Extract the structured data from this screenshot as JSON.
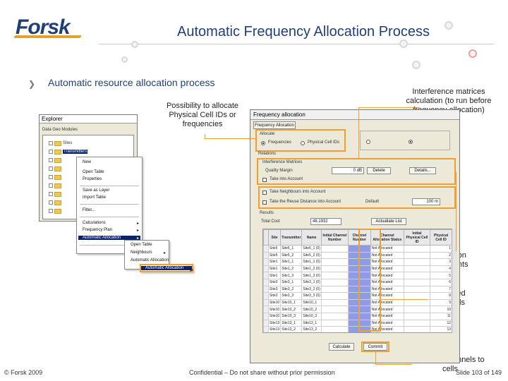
{
  "header": {
    "logo": "Forsk",
    "title": "Automatic Frequency Allocation Process"
  },
  "bullet": "Automatic resource allocation process",
  "annotations": {
    "possibility": "Possibility to allocate Physical Cell IDs or frequencies",
    "interference": "Interference matrices calculation (to run before frequency allocation)",
    "constraints": "Allocation constraints",
    "allocated": "Allocated channels",
    "commit": "Commit channels to cells"
  },
  "explorer": {
    "title": "Explorer",
    "toolbar": "Data Geo Modules",
    "selected_item": "Transmitters",
    "tree_items": [
      "Sites",
      "Transmitters",
      "",
      "",
      "",
      "",
      "",
      "",
      ""
    ]
  },
  "context_menu": {
    "items": [
      "New",
      "Open Table",
      "Properties",
      "Save as Layer",
      "Import Table",
      "Filter...",
      "Calculations",
      "Frequency Plan",
      "Automatic Allocation"
    ],
    "submenu_items": [
      "Open Table",
      "Neighbours",
      "Automatic Allocation"
    ],
    "highlighted": "Automatic Allocation"
  },
  "dialog": {
    "title": "Frequency allocation",
    "tab": "Frequency Allocation",
    "allocate_label": "Allocate",
    "opt_frequencies": "Frequencies",
    "opt_pci": "Physical Cell IDs",
    "relations_label": "Relations",
    "im_label": "Interference Matrices",
    "quality_margin": "Quality Margin",
    "quality_value": "0 dB",
    "take_account": "Take into Account",
    "take_neighbours": "Take Neighbours into Account",
    "take_distance": "Take the Reuse Distance into Account",
    "default_label": "Default",
    "default_value": "100 m",
    "results_label": "Results",
    "total_cost_label": "Total Cost",
    "total_cost_value": "48.1932",
    "calc_button": "Calculate",
    "commit_button": "Commit",
    "delete_button": "Delete",
    "details_button": "Details...",
    "save_button": "Actualiate List",
    "table_headers": [
      "Site",
      "Transmitter",
      "Name",
      "Initial Channel Number",
      "Channel Number",
      "Channel Allocation Status",
      "Initial Physical Cell ID",
      "Physical Cell ID"
    ],
    "rows": [
      [
        "Site5",
        "Site5_1",
        "Site5_1 (0)",
        "",
        "",
        "Not Allocated",
        "",
        "1"
      ],
      [
        "Site5",
        "Site5_2",
        "Site5_2 (0)",
        "",
        "",
        "Not Allocated",
        "",
        "2"
      ],
      [
        "Site1",
        "Site1_1",
        "Site1_1 (0)",
        "",
        "",
        "Not Allocated",
        "",
        "3"
      ],
      [
        "Site1",
        "Site1_2",
        "Site1_2 (0)",
        "",
        "",
        "Not Allocated",
        "",
        "4"
      ],
      [
        "Site1",
        "Site1_3",
        "Site1_3 (0)",
        "",
        "",
        "Not Allocated",
        "",
        "5"
      ],
      [
        "Site3",
        "Site3_1",
        "Site3_1 (0)",
        "",
        "",
        "Not Allocated",
        "",
        "6"
      ],
      [
        "Site3",
        "Site3_2",
        "Site3_2 (0)",
        "",
        "",
        "Not Allocated",
        "",
        "7"
      ],
      [
        "Site3",
        "Site3_3",
        "Site3_3 (0)",
        "",
        "",
        "Not Allocated",
        "",
        "8"
      ],
      [
        "Site10",
        "Site10_1",
        "Site10_1",
        "",
        "",
        "Not Allocated",
        "",
        "9"
      ],
      [
        "Site10",
        "Site10_2",
        "Site10_2",
        "",
        "",
        "Not Allocated",
        "",
        "10"
      ],
      [
        "Site10",
        "Site10_3",
        "Site10_3",
        "",
        "",
        "Not Allocated",
        "",
        "11"
      ],
      [
        "Site13",
        "Site13_1",
        "Site13_1",
        "",
        "",
        "Not Allocated",
        "",
        "12"
      ],
      [
        "Site13",
        "Site13_2",
        "Site13_2",
        "",
        "",
        "Not Allocated",
        "",
        "13"
      ]
    ]
  },
  "footer": {
    "copyright": "© Forsk 2009",
    "confidential": "Confidential – Do not share without prior permission",
    "slide": "Slide 103 of 149"
  },
  "colors": {
    "accent": "#f0a030",
    "brand": "#1f3f7a",
    "highlight": "#8e9ce6"
  }
}
